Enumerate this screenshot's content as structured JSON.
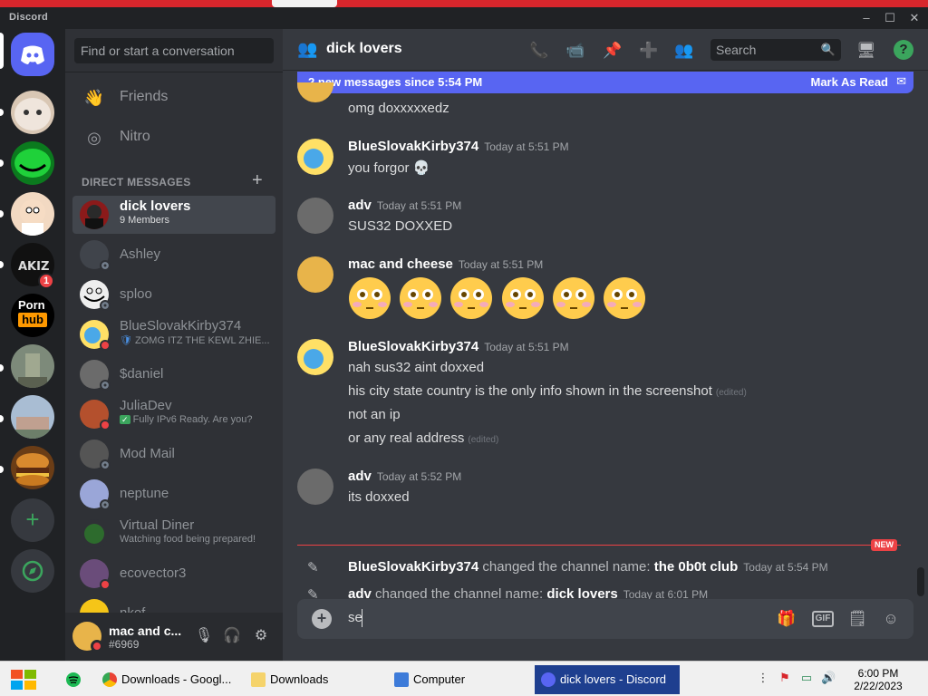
{
  "window": {
    "brand": "Discord",
    "controls": [
      "–",
      "☐",
      "✕"
    ]
  },
  "servers": {
    "badge_count": "1",
    "porn_line1": "Porn",
    "porn_line2": "hub"
  },
  "dm_sidebar": {
    "search_placeholder": "Find or start a conversation",
    "nav": [
      {
        "label": "Friends",
        "icon": "friends-icon"
      },
      {
        "label": "Nitro",
        "icon": "nitro-icon"
      }
    ],
    "dm_header": "DIRECT MESSAGES",
    "dms": [
      {
        "name": "dick lovers",
        "sub": "9 Members",
        "active": true
      },
      {
        "name": "Ashley",
        "sub": "",
        "status": "offline"
      },
      {
        "name": "sploo",
        "sub": "",
        "status": "offline"
      },
      {
        "name": "BlueSlovakKirby374",
        "sub": "ZOMG ITZ THE KEWL ZHIE...",
        "status": "dnd"
      },
      {
        "name": "$daniel",
        "sub": "",
        "status": "offline"
      },
      {
        "name": "JuliaDev",
        "sub": "Fully IPv6 Ready. Are you?",
        "status": "dnd"
      },
      {
        "name": "Mod Mail",
        "sub": "",
        "status": "offline"
      },
      {
        "name": "neptune",
        "sub": "",
        "status": "offline"
      },
      {
        "name": "Virtual Diner",
        "sub": "Watching food being prepared!",
        "status": ""
      },
      {
        "name": "ecovector3",
        "sub": "",
        "status": "dnd"
      },
      {
        "name": "nkef",
        "sub": "",
        "status": ""
      }
    ]
  },
  "user_panel": {
    "name": "mac and c...",
    "tag": "#6969"
  },
  "channel": {
    "name": "dick lovers",
    "search_placeholder": "Search"
  },
  "banner": {
    "text": "2 new messages since 5:54 PM",
    "action": "Mark As Read"
  },
  "messages": [
    {
      "text": "omg doxxxxxedz"
    },
    {
      "author": "BlueSlovakKirby374",
      "time": "Today at 5:51 PM",
      "lines": [
        "you forgor"
      ]
    },
    {
      "author": "adv",
      "time": "Today at 5:51 PM",
      "lines": [
        "SUS32 DOXXED"
      ]
    },
    {
      "author": "mac and cheese",
      "time": "Today at 5:51 PM",
      "emoji_count": 6
    },
    {
      "author": "BlueSlovakKirby374",
      "time": "Today at 5:51 PM",
      "lines": [
        "nah sus32 aint doxxed",
        "his city state country is the only info shown in the screenshot",
        "not an ip",
        "or any real address"
      ],
      "edited": "(edited)"
    },
    {
      "author": "adv",
      "time": "Today at 5:52 PM",
      "lines": [
        "its doxxed"
      ]
    }
  ],
  "new_tag": "NEW",
  "system_events": [
    {
      "actor": "BlueSlovakKirby374",
      "action": "changed the channel name:",
      "value": "the 0b0t club",
      "time": "Today at 5:54 PM"
    },
    {
      "actor": "adv",
      "action": "changed the channel name:",
      "value": "dick lovers",
      "time": "Today at 6:01 PM"
    }
  ],
  "composer": {
    "text": "se"
  },
  "taskbar": {
    "items": [
      {
        "label": "Downloads - Googl...",
        "icon": "chrome-icon"
      },
      {
        "label": "Downloads",
        "icon": "folder-icon"
      },
      {
        "label": "Computer",
        "icon": "computer-icon"
      },
      {
        "label": "dick lovers - Discord",
        "icon": "discord-icon",
        "active": true
      }
    ],
    "clock_time": "6:00 PM",
    "clock_date": "2/22/2023"
  },
  "colors": {
    "blurple": "#5865f2",
    "red": "#ed4245",
    "green": "#3ba55d"
  }
}
